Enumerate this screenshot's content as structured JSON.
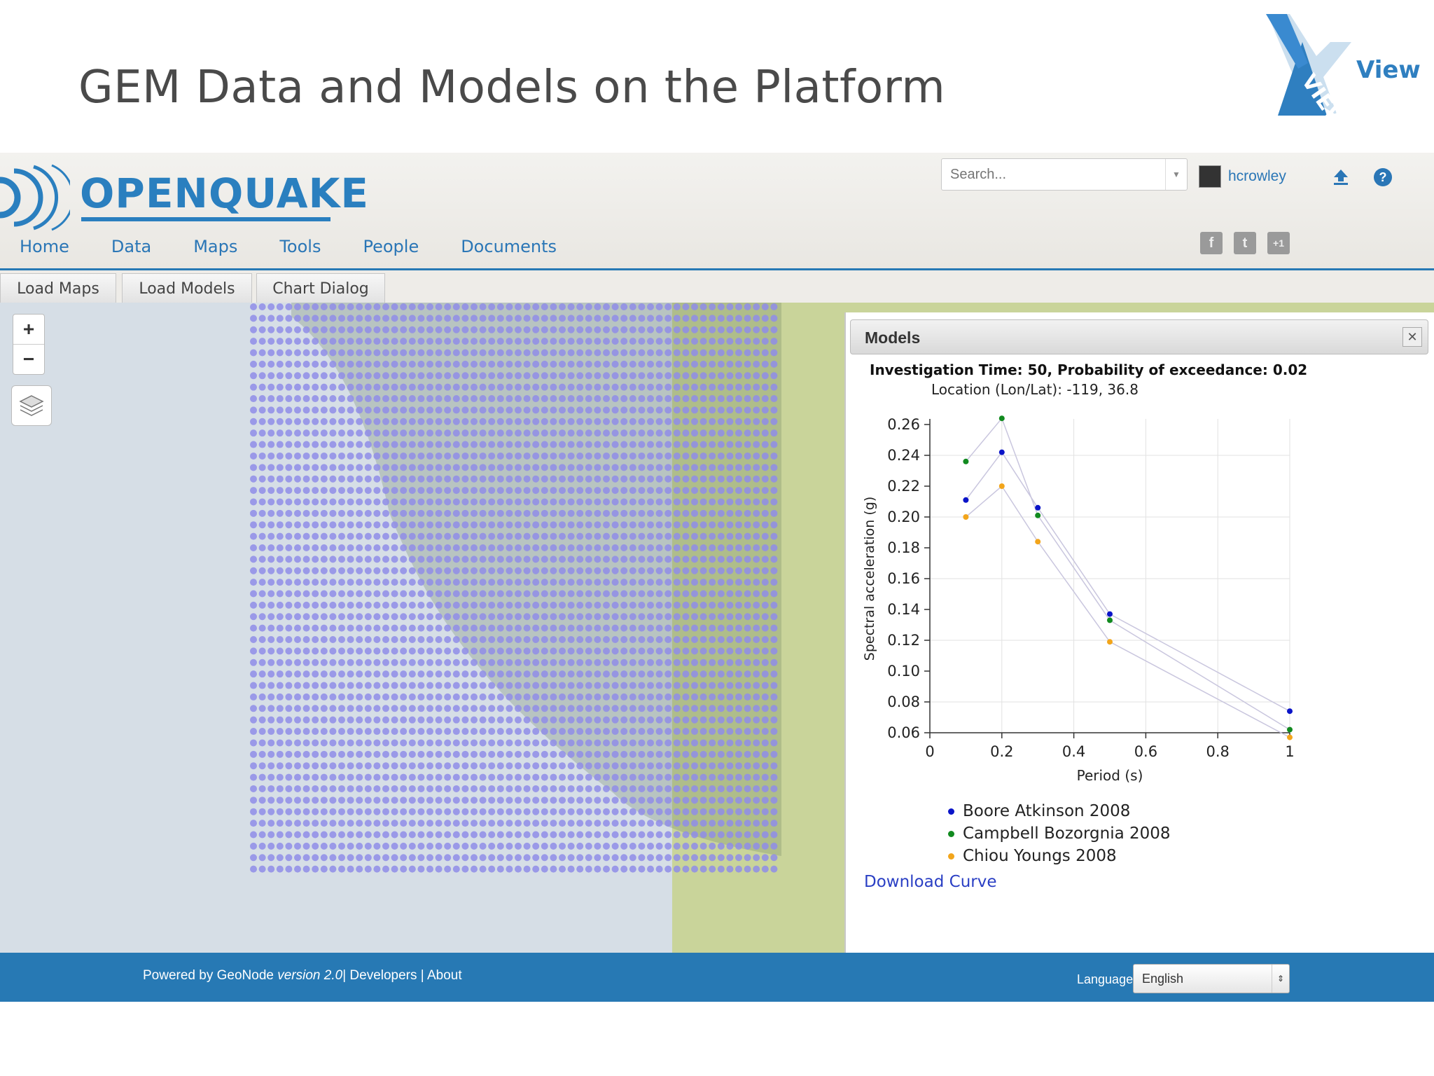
{
  "slide": {
    "title": "GEM Data and Models on the Platform",
    "brand_text": "View"
  },
  "header": {
    "logo_text": "OPENQUAKE",
    "search_placeholder": "Search...",
    "username": "hcrowley",
    "nav": [
      "Home",
      "Data",
      "Maps",
      "Tools",
      "People",
      "Documents"
    ]
  },
  "toolbar": {
    "buttons": [
      "Load Maps",
      "Load Models",
      "Chart Dialog"
    ]
  },
  "map": {
    "zoom_in": "+",
    "zoom_out": "−",
    "grid_color": "#8f8de8"
  },
  "panel": {
    "title": "Models",
    "close": "✕",
    "download_label": "Download Curve"
  },
  "chart_data": {
    "type": "scatter",
    "title": "Investigation Time: 50, Probability of exceedance: 0.02",
    "subtitle": "Location (Lon/Lat): -119, 36.8",
    "xlabel": "Period (s)",
    "ylabel": "Spectral acceleration (g)",
    "xlim": [
      0,
      1
    ],
    "ylim": [
      0.06,
      0.26
    ],
    "xticks": [
      "0",
      "0.2",
      "0.4",
      "0.6",
      "0.8",
      "1"
    ],
    "yticks": [
      "0.06",
      "0.08",
      "0.10",
      "0.12",
      "0.14",
      "0.16",
      "0.18",
      "0.20",
      "0.22",
      "0.24",
      "0.26"
    ],
    "legend_position": "bottom",
    "series": [
      {
        "name": "Boore Atkinson 2008",
        "color": "#0a14c8",
        "x": [
          0.1,
          0.2,
          0.3,
          0.5,
          1.0
        ],
        "y": [
          0.211,
          0.242,
          0.206,
          0.137,
          0.074
        ]
      },
      {
        "name": "Campbell Bozorgnia 2008",
        "color": "#118a1f",
        "x": [
          0.1,
          0.2,
          0.3,
          0.5,
          1.0
        ],
        "y": [
          0.236,
          0.264,
          0.201,
          0.133,
          0.062
        ]
      },
      {
        "name": "Chiou Youngs 2008",
        "color": "#f2a51b",
        "x": [
          0.1,
          0.2,
          0.3,
          0.5,
          1.0
        ],
        "y": [
          0.2,
          0.22,
          0.184,
          0.119,
          0.057
        ]
      }
    ]
  },
  "footer": {
    "powered_prefix": "Powered by GeoNode ",
    "version": "version 2.0",
    "links": "| Developers | About",
    "language_label": "Language",
    "language_value": "English"
  }
}
